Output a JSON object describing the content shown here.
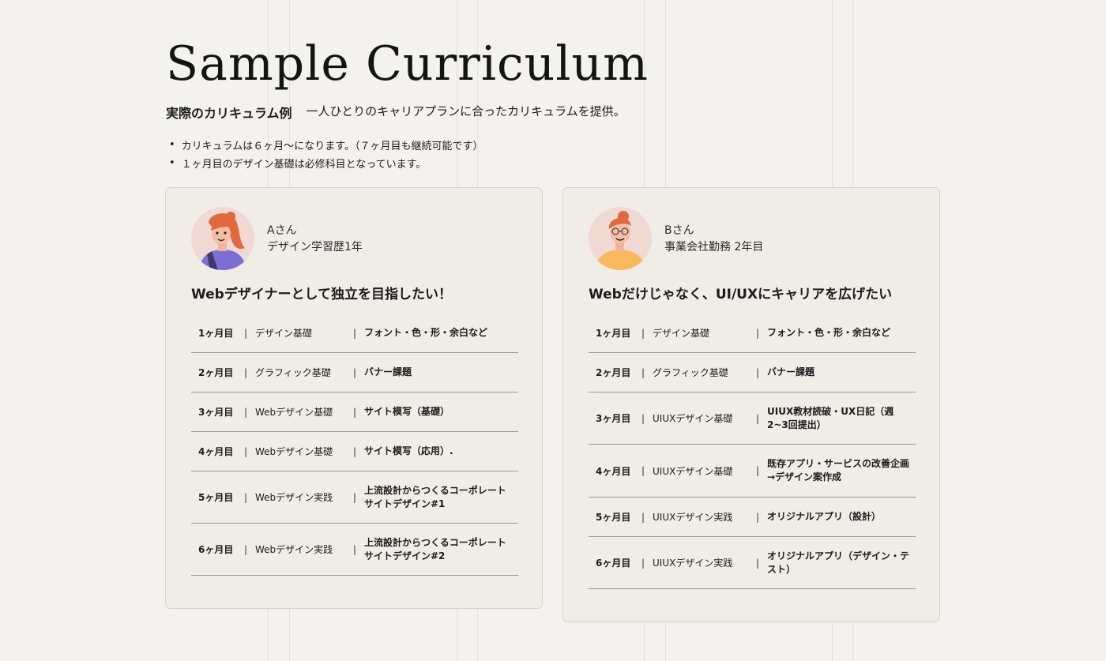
{
  "header": {
    "title": "Sample Curriculum",
    "subtitle_bold": "実際のカリキュラム例",
    "subtitle_text": "一人ひとりのキャリアプランに合ったカリキュラムを提供。"
  },
  "notes": [
    "カリキュラムは６ヶ月〜になります。（７ヶ月目も継続可能です）",
    "１ヶ月目のデザイン基礎は必修科目となっています。"
  ],
  "separator": "|",
  "cards": [
    {
      "name": "Aさん",
      "profile": "デザイン学習歴1年",
      "goal": "Webデザイナーとして独立を目指したい！",
      "rows": [
        {
          "month": "1ヶ月目",
          "course": "デザイン基礎",
          "content": "フォント・色・形・余白など"
        },
        {
          "month": "2ヶ月目",
          "course": "グラフィック基礎",
          "content": "バナー課題"
        },
        {
          "month": "3ヶ月目",
          "course": "Webデザイン基礎",
          "content": "サイト模写（基礎）"
        },
        {
          "month": "4ヶ月目",
          "course": "Webデザイン基礎",
          "content": "サイト模写（応用）."
        },
        {
          "month": "5ヶ月目",
          "course": "Webデザイン実践",
          "content": "上流設計からつくるコーポレートサイトデザイン#1"
        },
        {
          "month": "6ヶ月目",
          "course": "Webデザイン実践",
          "content": "上流設計からつくるコーポレートサイトデザイン#2"
        }
      ]
    },
    {
      "name": "Bさん",
      "profile": "事業会社勤務 2年目",
      "goal": "Webだけじゃなく、UI/UXにキャリアを広げたい",
      "rows": [
        {
          "month": "1ヶ月目",
          "course": "デザイン基礎",
          "content": "フォント・色・形・余白など"
        },
        {
          "month": "2ヶ月目",
          "course": "グラフィック基礎",
          "content": "バナー課題"
        },
        {
          "month": "3ヶ月目",
          "course": "UIUXデザイン基礎",
          "content": "UIUX教材読破・UX日記（週2~3回提出）"
        },
        {
          "month": "4ヶ月目",
          "course": "UIUXデザイン基礎",
          "content": "既存アプリ・サービスの改善企画→デザイン案作成"
        },
        {
          "month": "5ヶ月目",
          "course": "UIUXデザイン実践",
          "content": "オリジナルアプリ（設計）"
        },
        {
          "month": "6ヶ月目",
          "course": "UIUXデザイン実践",
          "content": "オリジナルアプリ（デザイン・テスト）"
        }
      ]
    }
  ]
}
